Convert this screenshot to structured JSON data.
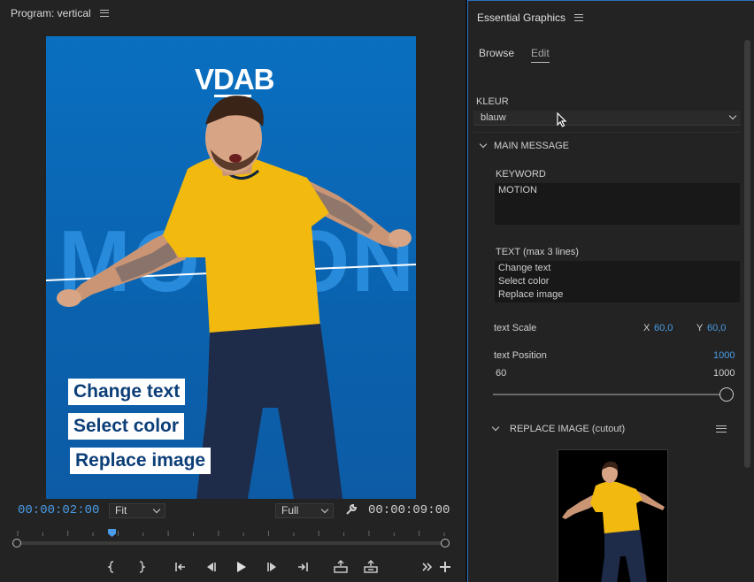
{
  "program": {
    "title": "Program: vertical",
    "timecode_current": "00:00:02:00",
    "timecode_total": "00:00:09:00",
    "fit_dropdown": "Fit",
    "resolution_dropdown": "Full",
    "playhead_fraction": 0.22
  },
  "video": {
    "logo_text": "VDAB",
    "keyword_text": "MOTION",
    "labels": [
      "Change text",
      "Select color",
      "Replace image"
    ]
  },
  "eg": {
    "title": "Essential Graphics",
    "tabs": [
      "Browse",
      "Edit"
    ],
    "active_tab": "Edit",
    "kleur_label": "KLEUR",
    "kleur_value": "blauw",
    "main_message_label": "MAIN MESSAGE",
    "keyword_label": "KEYWORD",
    "keyword_value": "MOTION",
    "text_label": "TEXT (max 3 lines)",
    "text_lines": [
      "Change text",
      "Select color",
      "Replace image"
    ],
    "text_scale_label": "text Scale",
    "scale_x_label": "X",
    "scale_x_value": "60,0",
    "scale_y_label": "Y",
    "scale_y_value": "60,0",
    "text_position_label": "text Position",
    "text_position_value": "1000",
    "slider_min": "60",
    "slider_max": "1000",
    "slider_fraction": 1.0,
    "replace_image_label": "REPLACE IMAGE (cutout)"
  },
  "colors": {
    "accent": "#4a9ce8",
    "video_bg": "#0a6fc0",
    "label_text": "#0c3e78",
    "shirt": "#f2b90f"
  }
}
